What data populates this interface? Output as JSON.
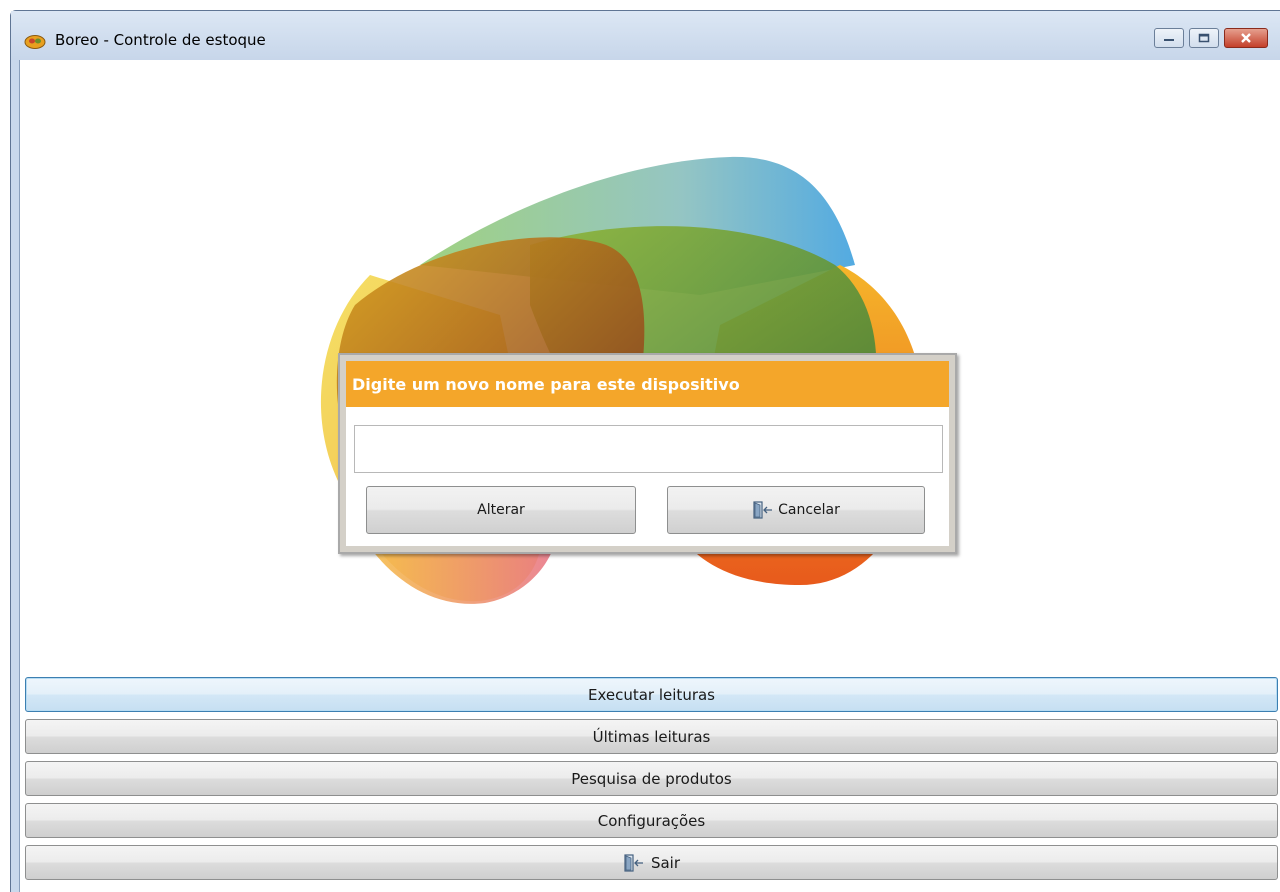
{
  "window": {
    "title": "Boreo - Controle de estoque",
    "icon": "app-logo-icon",
    "controls": [
      "minimize-icon",
      "maximize-icon",
      "close-icon"
    ]
  },
  "colors": {
    "dialog_header": "#f4a62a",
    "titlebar": "#c9d9ec",
    "active_border": "#3c7fb1"
  },
  "dialog": {
    "title": "Digite um novo nome para este dispositivo",
    "input_value": "",
    "alterar_label": "Alterar",
    "cancelar_label": "Cancelar",
    "cancelar_icon": "exit-door-icon"
  },
  "menu": {
    "executar": "Executar leituras",
    "ultimas": "Últimas leituras",
    "pesquisa": "Pesquisa de produtos",
    "configuracoes": "Configurações",
    "sair": "Sair",
    "sair_icon": "exit-door-icon"
  }
}
